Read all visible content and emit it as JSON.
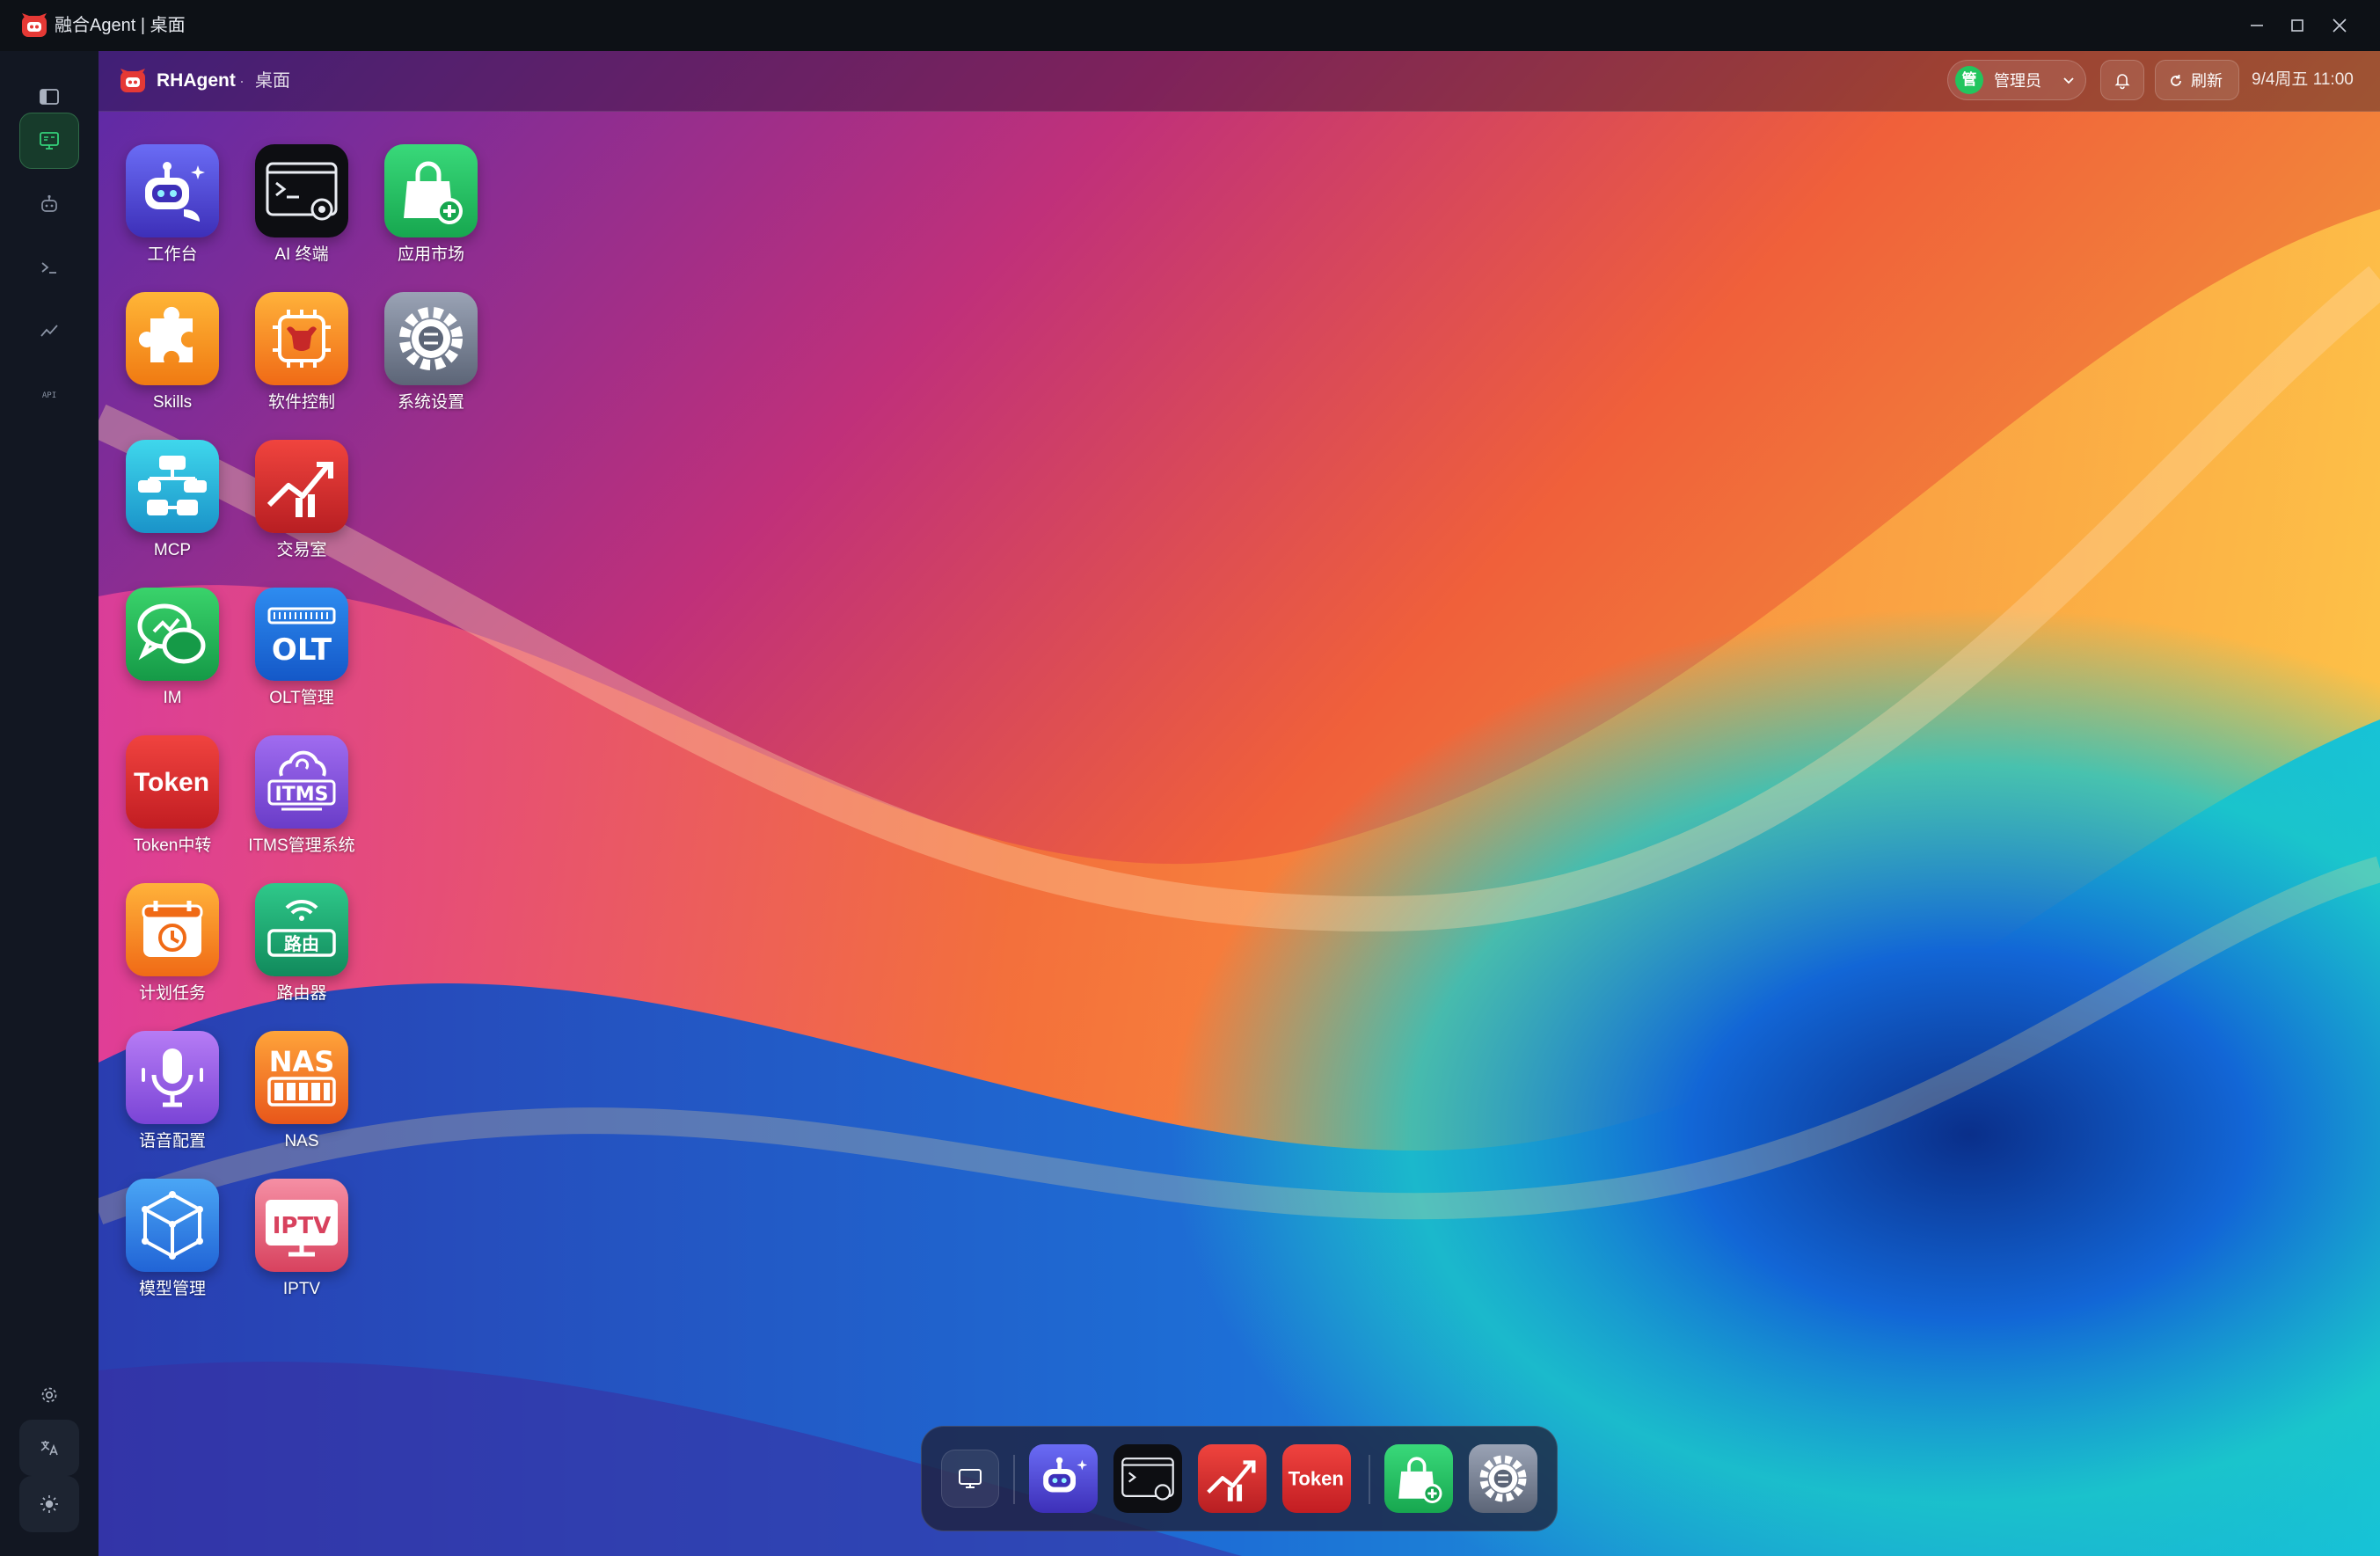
{
  "window": {
    "title": "融合Agent | 桌面"
  },
  "header": {
    "brand": "RHAgent",
    "separator": "·",
    "breadcrumb": "桌面",
    "user_initial": "管",
    "user_name": "管理员",
    "refresh_label": "刷新",
    "datetime": "9/4周五 11:00"
  },
  "rail": {
    "items": [
      {
        "name": "desktop",
        "icon": "monitor-icon",
        "active": true
      },
      {
        "name": "agent",
        "icon": "robot-icon",
        "active": false
      },
      {
        "name": "terminal",
        "icon": "terminal-icon",
        "active": false
      },
      {
        "name": "trading",
        "icon": "trend-icon",
        "active": false
      },
      {
        "name": "api",
        "icon": "api-icon",
        "active": false
      }
    ],
    "bottom": [
      {
        "name": "settings",
        "icon": "gear-icon"
      },
      {
        "name": "language",
        "icon": "translate-icon"
      },
      {
        "name": "theme",
        "icon": "sun-icon"
      }
    ]
  },
  "desktop_icons": [
    {
      "label": "工作台",
      "icon": "robot-chat-icon"
    },
    {
      "label": "AI 终端",
      "icon": "terminal-icon"
    },
    {
      "label": "应用市场",
      "icon": "shopping-bag-icon"
    },
    {
      "label": "Skills",
      "icon": "puzzle-icon"
    },
    {
      "label": "软件控制",
      "icon": "bull-chip-icon"
    },
    {
      "label": "系统设置",
      "icon": "gear-icon"
    },
    {
      "label": "MCP",
      "icon": "network-plug-icon"
    },
    {
      "label": "交易室",
      "icon": "stock-chart-icon"
    },
    {
      "label": "IM",
      "icon": "chat-bubbles-icon"
    },
    {
      "label": "OLT管理",
      "icon": "olt-icon"
    },
    {
      "label": "Token中转",
      "icon": "token-icon"
    },
    {
      "label": "ITMS管理系统",
      "icon": "itms-cloud-icon"
    },
    {
      "label": "计划任务",
      "icon": "calendar-clock-icon"
    },
    {
      "label": "路由器",
      "icon": "router-icon"
    },
    {
      "label": "语音配置",
      "icon": "microphone-icon"
    },
    {
      "label": "NAS",
      "icon": "nas-icon"
    },
    {
      "label": "模型管理",
      "icon": "cube-icon"
    },
    {
      "label": "IPTV",
      "icon": "iptv-icon"
    }
  ],
  "tile_text": {
    "olt": "OLT",
    "token": "Token",
    "itms": "ITMS",
    "nas": "NAS",
    "iptv": "IPTV",
    "router": "路由"
  },
  "dock": [
    {
      "name": "show-desktop",
      "icon": "monitor-icon"
    },
    {
      "name": "workbench",
      "icon": "robot-chat-icon"
    },
    {
      "name": "ai-terminal",
      "icon": "terminal-icon"
    },
    {
      "name": "trading-room",
      "icon": "stock-chart-icon"
    },
    {
      "name": "token-relay",
      "icon": "token-icon"
    },
    {
      "name": "app-market",
      "icon": "shopping-bag-icon"
    },
    {
      "name": "system-settings",
      "icon": "gear-icon"
    }
  ],
  "colors": {
    "accent": "#22c55e",
    "rail_bg": "#121722",
    "titlebar_bg": "#0d1116"
  }
}
